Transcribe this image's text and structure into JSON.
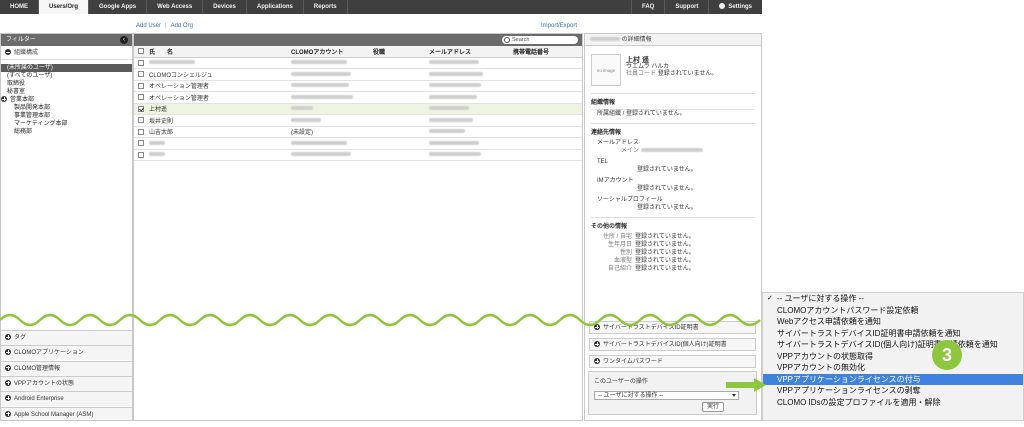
{
  "nav": {
    "tabs": [
      "HOME",
      "Users/Org",
      "Google Apps",
      "Web Access",
      "Devices",
      "Applications",
      "Reports"
    ],
    "active_index": 1,
    "right": [
      "FAQ",
      "Support",
      "Settings"
    ]
  },
  "links": {
    "add_user": "Add User",
    "add_org": "Add Org",
    "import_export": "Import/Export"
  },
  "filter": {
    "title": "フィルター",
    "group_label": "組織構成",
    "tree": [
      {
        "label": "(未所属のユーザ)",
        "level": 0,
        "selected": true
      },
      {
        "label": "(すべてのユーザ)",
        "level": 0
      },
      {
        "label": "取締役",
        "level": 0
      },
      {
        "label": "秘書室",
        "level": 0
      },
      {
        "label": "営業本部",
        "level": 0,
        "expandable": true
      },
      {
        "label": "製品開発本部",
        "level": 1
      },
      {
        "label": "事業管理本部",
        "level": 1
      },
      {
        "label": "マーケティング本部",
        "level": 1
      },
      {
        "label": "総務部",
        "level": 1
      }
    ],
    "sections": [
      "タグ",
      "CLOMOアプリケーション",
      "CLOMO管理情報",
      "VPPアカウントの状態",
      "Android Enterprise",
      "Apple School Manager (ASM)"
    ]
  },
  "list": {
    "search_placeholder": "Search",
    "columns": {
      "name": "氏　　名",
      "account": "CLOMOアカウント",
      "role": "役職",
      "mail": "メールアドレス",
      "tel": "携帯電話番号"
    },
    "rows": [
      {
        "name": "",
        "account": "",
        "role": "",
        "blur_name": 46,
        "blur_acct": 56,
        "blur_mail": 50
      },
      {
        "name": "CLOMOコンシェルジュ",
        "account": "",
        "role": "",
        "blur_acct": 60,
        "blur_mail": 54
      },
      {
        "name": "オペレーション管理者",
        "account": "",
        "role": "",
        "blur_acct": 58,
        "blur_mail": 52
      },
      {
        "name": "オペレーション管理者",
        "account": "",
        "role": "",
        "blur_acct": 62,
        "blur_mail": 48
      },
      {
        "name": "上村遥",
        "account": "",
        "role": "",
        "blur_acct": 22,
        "blur_mail": 40,
        "checked": true
      },
      {
        "name": "坂井史則",
        "account": "",
        "role": "",
        "blur_acct": 30,
        "blur_mail": 44
      },
      {
        "name": "山吉太郎",
        "account": "(未設定)",
        "role": "",
        "blur_mail": 36
      },
      {
        "name": "",
        "account": "",
        "role": "",
        "blur_name": 16,
        "blur_acct": 56,
        "blur_mail": 50
      },
      {
        "name": "",
        "account": "",
        "role": "",
        "blur_name": 16,
        "blur_acct": 60,
        "blur_mail": 52
      }
    ]
  },
  "detail": {
    "header_suffix": "の詳細情報",
    "photo": "no image",
    "name": "上村 遥",
    "kana": "ウエムラ ハルカ",
    "emp_label": "社員コード",
    "not_registered": "登録されていません。",
    "org_section": "組織情報",
    "org_value": "所属組織 / 登録されていません。",
    "contact_section": "連絡先情報",
    "mail_label": "メールアドレス",
    "main_label": "メイン",
    "tel_label": "TEL",
    "im_label": "IMアカウント",
    "social_label": "ソーシャルプロフィール",
    "other_section": "その他の情報",
    "other_fields": [
      "住所 / 自宅",
      "生年月日",
      "性別",
      "血液型",
      "自己紹介"
    ],
    "accordion": [
      "サイバートラストデバイスID証明書",
      "サイバートラストデバイスID(個人向け)証明書",
      "ワンタイムパスワード"
    ],
    "op_title": "このユーザーの操作",
    "op_select": "-- ユーザに対する操作 --",
    "run_button": "実行"
  },
  "dropdown": {
    "items": [
      "-- ユーザに対する操作 --",
      "CLOMOアカウントパスワード設定依頼",
      "Webアクセス申請依頼を通知",
      "サイバートラストデバイスID証明書申請依頼を通知",
      "サイバートラストデバイスID(個人向け)証明書申請依頼を通知",
      "VPPアカウントの状態取得",
      "VPPアカウントの無効化",
      "VPPアプリケーションライセンスの付与",
      "VPPアプリケーションライセンスの剥奪",
      "CLOMO IDsの設定プロファイルを適用・解除"
    ],
    "checked_index": 0,
    "selected_index": 7
  },
  "callout": {
    "step": "3"
  },
  "colors": {
    "accent_green": "#8ec63f",
    "selection_blue": "#3f82e0",
    "nav_dark": "#3f3f3f"
  }
}
